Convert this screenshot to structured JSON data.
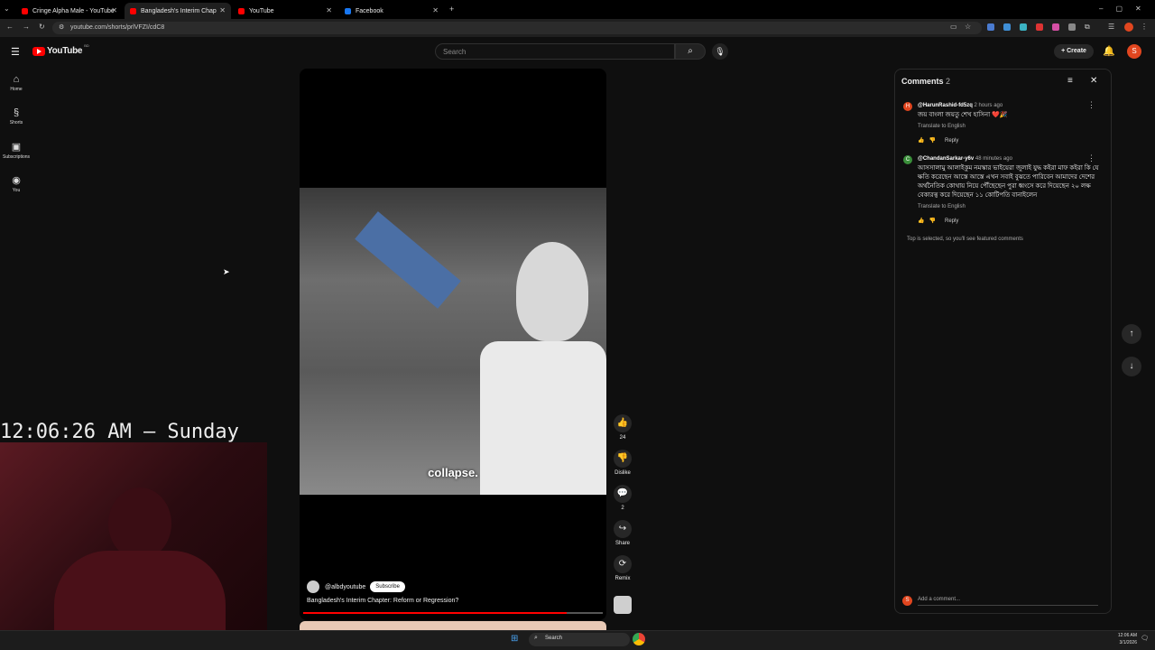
{
  "browser": {
    "tabs": [
      {
        "title": "Cringe Alpha Male - YouTube",
        "favicon_color": "#ff0000",
        "active": false
      },
      {
        "title": "Bangladesh's Interim Chap",
        "favicon_color": "#ff0000",
        "active": true
      },
      {
        "title": "YouTube",
        "favicon_color": "#ff0000",
        "active": false
      },
      {
        "title": "Facebook",
        "favicon_color": "#1877f2",
        "active": false
      }
    ],
    "url": "youtube.com/shorts/prlVFZI/cdC8",
    "new_tab": "+"
  },
  "youtube": {
    "logo_text": "YouTube",
    "logo_sup": "BD",
    "search_placeholder": "Search",
    "create_label": "Create",
    "avatar_letter": "S",
    "sidebar": [
      {
        "icon": "home-icon",
        "glyph": "⌂",
        "label": "Home"
      },
      {
        "icon": "shorts-icon",
        "glyph": "§",
        "label": "Shorts"
      },
      {
        "icon": "subscriptions-icon",
        "glyph": "▣",
        "label": "Subscriptions"
      },
      {
        "icon": "you-icon",
        "glyph": "◉",
        "label": "You"
      }
    ]
  },
  "short": {
    "caption": "collapse.",
    "channel": "@albdyoutube",
    "subscribe_label": "Subscribe",
    "title": "Bangladesh's Interim Chapter: Reform or Regression?",
    "progress": 0.88,
    "actions": {
      "like_count": "24",
      "dislike_label": "Dislike",
      "comment_count": "2",
      "share_label": "Share",
      "remix_label": "Remix"
    }
  },
  "overlay": {
    "clock": "12:06:26 AM – Sunday"
  },
  "comments": {
    "header": "Comments",
    "count": "2",
    "items": [
      {
        "avatar_letter": "H",
        "avatar_color": "#e1461f",
        "user": "@HarunRashid-fd5zq",
        "time": "2 hours ago",
        "text": "জয় বাংলা জয়তু শেখ হাসিনা ❤️🎉",
        "translate": "Translate to English",
        "reply": "Reply"
      },
      {
        "avatar_letter": "C",
        "avatar_color": "#3a8f3a",
        "user": "@ChandanSarkar-y6v",
        "time": "48 minutes ago",
        "text": "আসসালামু আলাইকুম নমস্কার ভাইয়েরা জুলাই যুদ্ধ কইরা মাফ কইরা কি যে ক্ষতি করেছেন আস্তে আস্তে এখন সবাই বুঝতে পারিবেন আমাদের দেশের অর্থনৈতিক কোথায় নিয়ে পৌঁছেছেন পুরা ধ্বংসে করে দিয়েছেন ২০ লক্ষ বেকারত্ব করে দিয়েছেন ১১ কোটিপতি বানাইলেন",
        "translate": "Translate to English",
        "reply": "Reply"
      }
    ],
    "footer_note": "Top is selected, so you'll see featured comments",
    "add_placeholder": "Add a comment..."
  },
  "taskbar": {
    "search_label": "Search",
    "time": "12:06 AM",
    "date": "3/1/2026"
  }
}
